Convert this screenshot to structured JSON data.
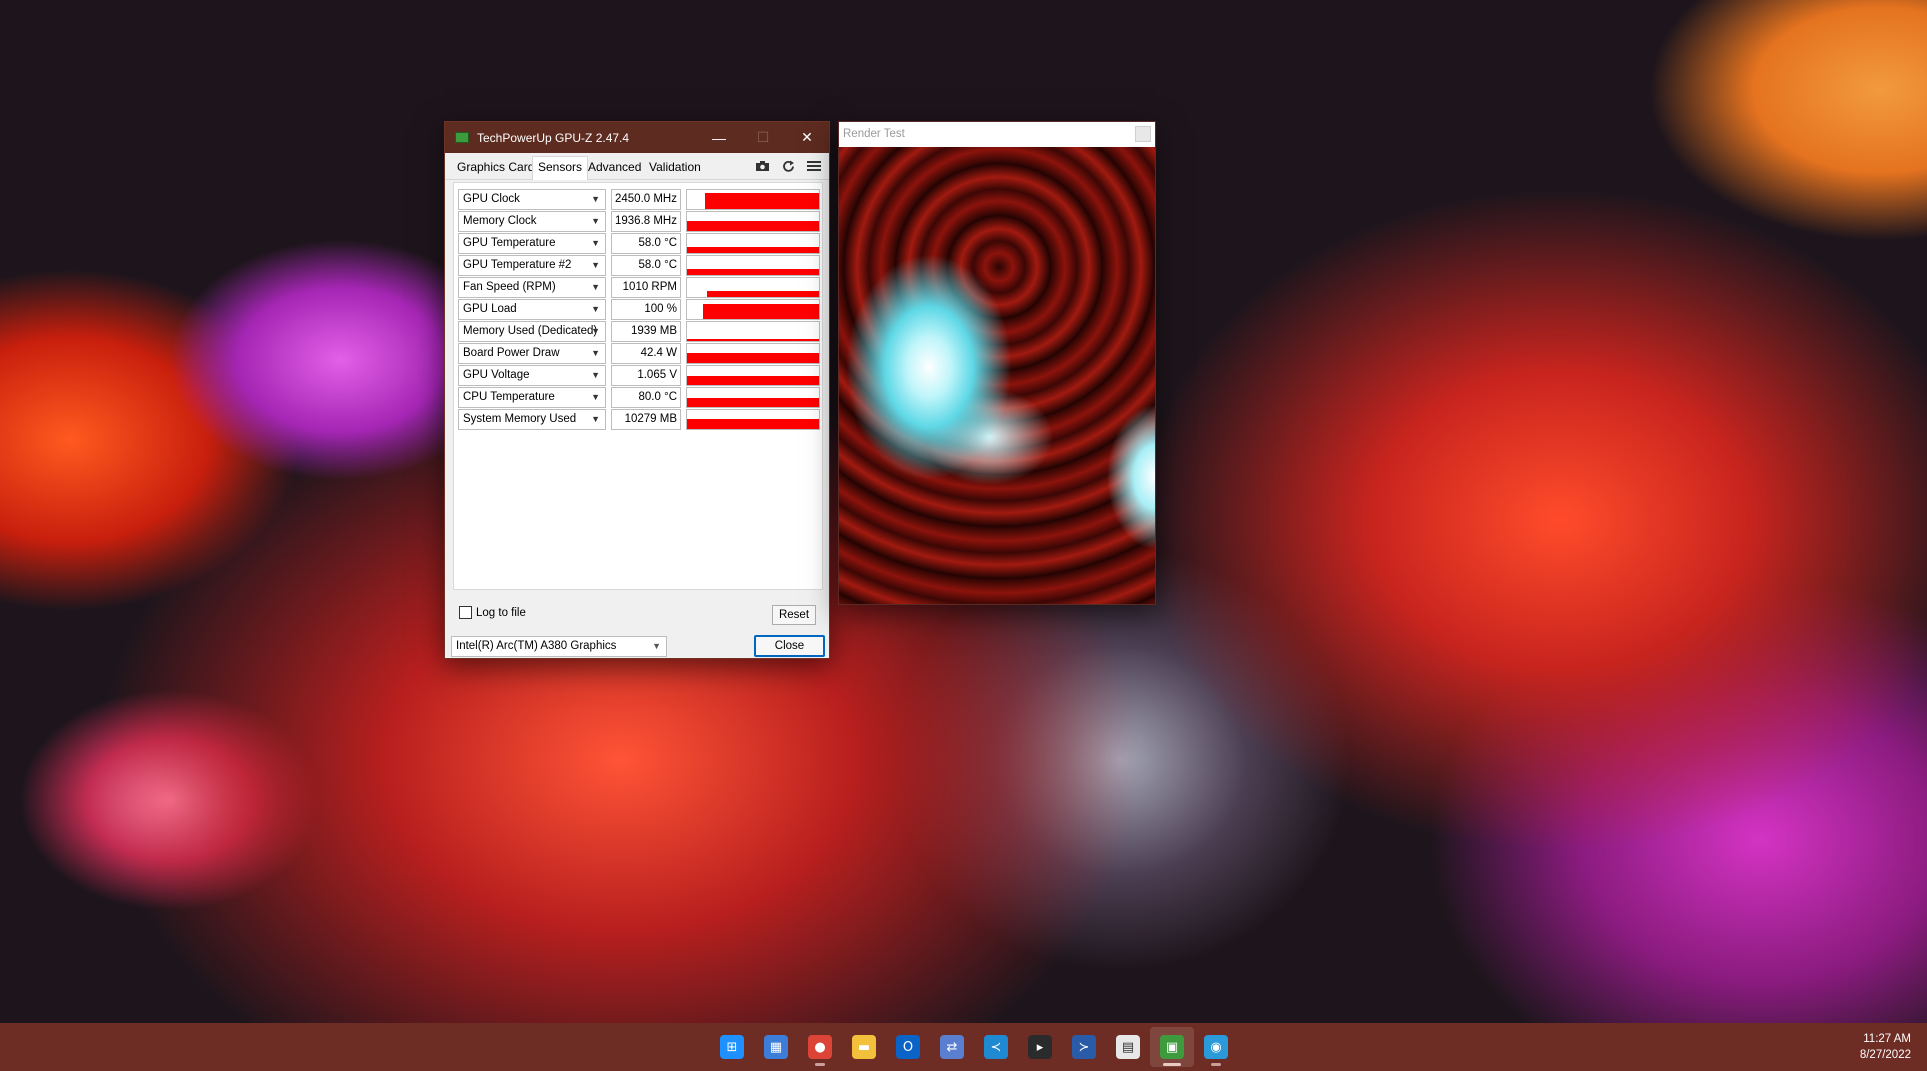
{
  "gpuz": {
    "title": "TechPowerUp GPU-Z 2.47.4",
    "window_buttons": {
      "minimize": "—",
      "maximize": "☐",
      "close": "✕"
    },
    "tabs": [
      {
        "label": "Graphics Card",
        "active": false
      },
      {
        "label": "Sensors",
        "active": true
      },
      {
        "label": "Advanced",
        "active": false
      },
      {
        "label": "Validation",
        "active": false
      }
    ],
    "toolbar_icons": [
      "camera-icon",
      "refresh-icon",
      "menu-icon"
    ],
    "sensors": [
      {
        "name": "GPU Clock",
        "value": "2450.0 MHz",
        "graph_level": 0.85,
        "graph_start": 0.14
      },
      {
        "name": "Memory Clock",
        "value": "1936.8 MHz",
        "graph_level": 0.55,
        "graph_start": 0.0
      },
      {
        "name": "GPU Temperature",
        "value": "58.0 °C",
        "graph_level": 0.3,
        "graph_start": 0.0
      },
      {
        "name": "GPU Temperature #2",
        "value": "58.0 °C",
        "graph_level": 0.3,
        "graph_start": 0.0
      },
      {
        "name": "Fan Speed (RPM)",
        "value": "1010 RPM",
        "graph_level": 0.3,
        "graph_start": 0.15
      },
      {
        "name": "GPU Load",
        "value": "100 %",
        "graph_level": 0.8,
        "graph_start": 0.12
      },
      {
        "name": "Memory Used (Dedicated)",
        "value": "1939 MB",
        "graph_level": 0.12,
        "graph_start": 0.0
      },
      {
        "name": "Board Power Draw",
        "value": "42.4 W",
        "graph_level": 0.55,
        "graph_start": 0.0
      },
      {
        "name": "GPU Voltage",
        "value": "1.065 V",
        "graph_level": 0.45,
        "graph_start": 0.0
      },
      {
        "name": "CPU Temperature",
        "value": "80.0 °C",
        "graph_level": 0.5,
        "graph_start": 0.0
      },
      {
        "name": "System Memory Used",
        "value": "10279 MB",
        "graph_level": 0.55,
        "graph_start": 0.0
      }
    ],
    "log_to_file_label": "Log to file",
    "log_to_file_checked": false,
    "reset_label": "Reset",
    "gpu_select_value": "Intel(R) Arc(TM) A380 Graphics",
    "close_label": "Close",
    "graph_color": "#ff0000"
  },
  "render_test": {
    "title": "Render Test"
  },
  "taskbar": {
    "icons": [
      {
        "name": "windows-start-icon",
        "glyph": "⊞",
        "color": "#1e90ff",
        "active": false,
        "running": false
      },
      {
        "name": "photos-icon",
        "glyph": "▦",
        "color": "#3b7dd8",
        "active": false,
        "running": false
      },
      {
        "name": "chrome-icon",
        "glyph": "●",
        "color": "#db4437",
        "active": false,
        "running": true
      },
      {
        "name": "file-explorer-icon",
        "glyph": "▬",
        "color": "#f3c03b",
        "active": false,
        "running": false
      },
      {
        "name": "outlook-icon",
        "glyph": "O",
        "color": "#0a64c8",
        "active": false,
        "running": false
      },
      {
        "name": "network-icon",
        "glyph": "⇄",
        "color": "#5a7fd0",
        "active": false,
        "running": false
      },
      {
        "name": "vscode-icon",
        "glyph": "≺",
        "color": "#1f8ad2",
        "active": false,
        "running": false
      },
      {
        "name": "terminal-icon",
        "glyph": "▸",
        "color": "#2b2b2b",
        "active": false,
        "running": false
      },
      {
        "name": "powershell-icon",
        "glyph": "≻",
        "color": "#2a5ba8",
        "active": false,
        "running": false
      },
      {
        "name": "store-icon",
        "glyph": "▤",
        "color": "#e8e8e8",
        "active": false,
        "running": false
      },
      {
        "name": "gpuz-taskbar-icon",
        "glyph": "▣",
        "color": "#3d9b3d",
        "active": true,
        "running": true
      },
      {
        "name": "globe-app-icon",
        "glyph": "◉",
        "color": "#2a9ad8",
        "active": false,
        "running": true
      }
    ],
    "time": "11:27 AM",
    "date": "8/27/2022"
  }
}
